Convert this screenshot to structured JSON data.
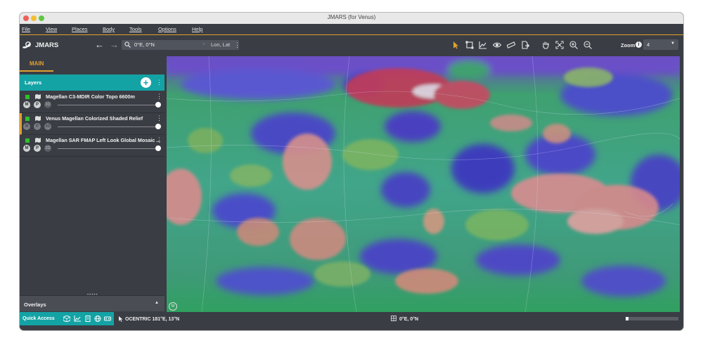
{
  "window": {
    "title": "JMARS (for Venus)"
  },
  "menu": [
    "File",
    "View",
    "Places",
    "Body",
    "Tools",
    "Options",
    "Help"
  ],
  "toolbar": {
    "app_name": "JMARS",
    "search_value": "0°E, 0°N",
    "search_placeholder": "Lon, Lat",
    "zoom_label": "Zoom",
    "zoom_value": "4",
    "tools": [
      "select-arrow-icon",
      "resize-icon",
      "chart-icon",
      "eye-icon",
      "ruler-icon",
      "export-icon",
      "pan-hand-icon",
      "fit-icon",
      "zoom-in-icon",
      "zoom-out-icon"
    ]
  },
  "left_panel": {
    "tab_main": "MAIN",
    "layers_title": "Layers",
    "layers": [
      {
        "name": "Magellan C3-MDIR Color Topo 6600m",
        "selected": false
      },
      {
        "name": "Venus Magellan Colorized Shaded Relief",
        "selected": true
      },
      {
        "name": "Magellan SAR FMAP Left Look Global Mosaic ...",
        "selected": false
      }
    ],
    "layer_buttons": {
      "m": "M",
      "p": "P",
      "d": "3D"
    },
    "overlays_title": "Overlays"
  },
  "status": {
    "quick_access": "Quick Access",
    "cursor_coord": "OCENTRIC  181°E, 13°N",
    "center_coord": "0°E, 0°N",
    "progress": 0.05
  },
  "map": {
    "badge": "M",
    "body": "Venus"
  },
  "colors": {
    "accent": "#e0a030",
    "teal": "#14a3a5",
    "panel": "#3a3d44"
  }
}
